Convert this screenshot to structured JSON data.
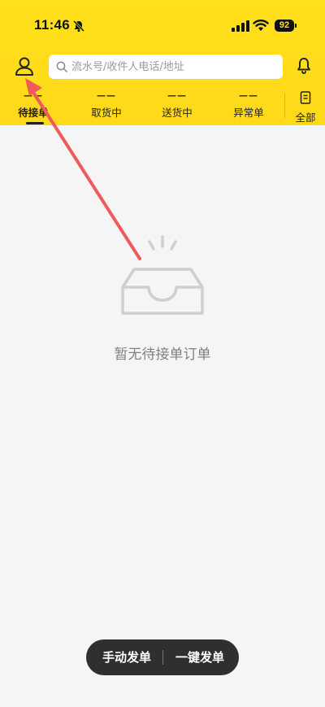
{
  "status_bar": {
    "time": "11:46",
    "battery": "92",
    "icons": [
      "bell-muted-icon",
      "signal-icon",
      "wifi-icon",
      "battery-icon"
    ]
  },
  "header": {
    "profile_icon": "user-icon",
    "search_placeholder": "流水号/收件人电话/地址",
    "notification_icon": "bell-icon",
    "brand_color": "#ffe01a"
  },
  "tabs": [
    {
      "count": "——",
      "label": "待接单",
      "active": true
    },
    {
      "count": "——",
      "label": "取货中",
      "active": false
    },
    {
      "count": "——",
      "label": "送货中",
      "active": false
    },
    {
      "count": "——",
      "label": "异常单",
      "active": false
    }
  ],
  "all_tab": {
    "label": "全部",
    "icon": "list-icon"
  },
  "empty_state": {
    "message": "暂无待接单订单",
    "icon": "empty-box-icon"
  },
  "bottom_actions": {
    "manual": "手动发单",
    "one_click": "一键发单"
  },
  "annotation": {
    "type": "red-arrow",
    "color": "#f05a5a"
  }
}
